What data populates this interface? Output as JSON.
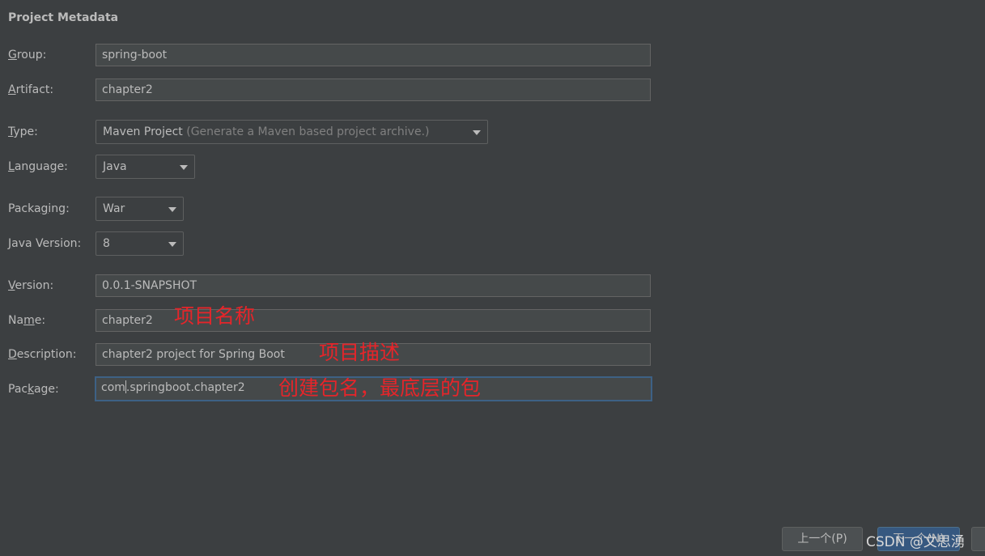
{
  "section": {
    "title": "Project Metadata"
  },
  "fields": {
    "group": {
      "label_first": "G",
      "label_rest": "roup:",
      "value": "spring-boot"
    },
    "artifact": {
      "label_first": "A",
      "label_rest": "rtifact:",
      "value": "chapter2"
    },
    "type": {
      "label_first": "T",
      "label_rest": "ype:",
      "value": "Maven Project",
      "hint": "(Generate a Maven based project archive.)"
    },
    "language": {
      "label_first": "L",
      "label_rest": "anguage:",
      "value": "Java"
    },
    "packaging": {
      "label_pre": "Packa",
      "label_u": "g",
      "label_rest": "ing:",
      "value": "War"
    },
    "java_version": {
      "label_first": "J",
      "label_rest": "ava Version:",
      "value": "8"
    },
    "version": {
      "label_first": "V",
      "label_rest": "ersion:",
      "value": "0.0.1-SNAPSHOT"
    },
    "name": {
      "label_pre": "Na",
      "label_u": "m",
      "label_rest": "e:",
      "value": "chapter2"
    },
    "description": {
      "label_first": "D",
      "label_rest": "escription:",
      "value": "chapter2 project for Spring Boot"
    },
    "package": {
      "label_pre": "Pac",
      "label_u": "k",
      "label_rest": "age:",
      "value_before_caret": "com",
      "value_after_caret": ".springboot.chapter2"
    }
  },
  "annotations": {
    "name": "项目名称",
    "description": "项目描述",
    "package": "创建包名，最底层的包"
  },
  "buttons": {
    "prev": "上一个(P)",
    "next": "下一个(N)"
  },
  "watermark": "CSDN @文思湧",
  "colors": {
    "background": "#3c3f41",
    "annotation": "#e5252a",
    "focus_border": "#3d6185"
  }
}
